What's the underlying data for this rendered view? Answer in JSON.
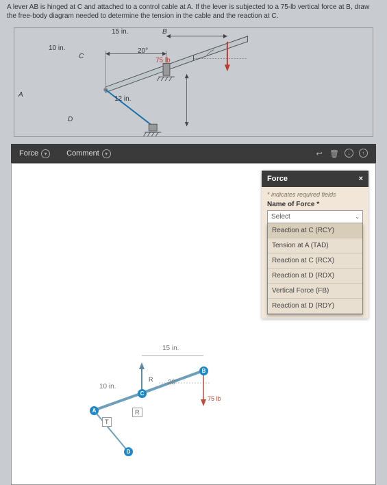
{
  "prompt": "A lever AB is hinged at C and attached to a control cable at A. If the lever is subjected to a 75-lb vertical force at B, draw the free-body diagram needed to determine the tension in the cable and the reaction at C.",
  "diagram": {
    "len_ac": "10 in.",
    "len_cb": "15 in.",
    "angle": "20°",
    "load": "75 lb",
    "height": "12 in.",
    "labels": {
      "A": "A",
      "B": "B",
      "C": "C",
      "D": "D"
    }
  },
  "toolbar": {
    "force_label": "Force",
    "comment_label": "Comment",
    "icons": {
      "undo": "↩",
      "trash": "🗑",
      "info_down": "ⓘ",
      "info_up": "ⓘ"
    }
  },
  "force_panel": {
    "title": "Force",
    "close": "×",
    "hint": "* indicates required fields",
    "field_label": "Name of Force *",
    "select_placeholder": "Select",
    "options": [
      "Reaction at C (RCY)",
      "Tension at A (TAD)",
      "Reaction at C (RCX)",
      "Reaction at D (RDX)",
      "Vertical Force (FB)",
      "Reaction at D (RDY)"
    ],
    "selected_index": 0
  },
  "fbd": {
    "len_ac": "10 in.",
    "len_cb": "15 in.",
    "angle": "20°",
    "load": "75 lb",
    "rcx": "R",
    "rcy": "R",
    "tad": "T"
  }
}
